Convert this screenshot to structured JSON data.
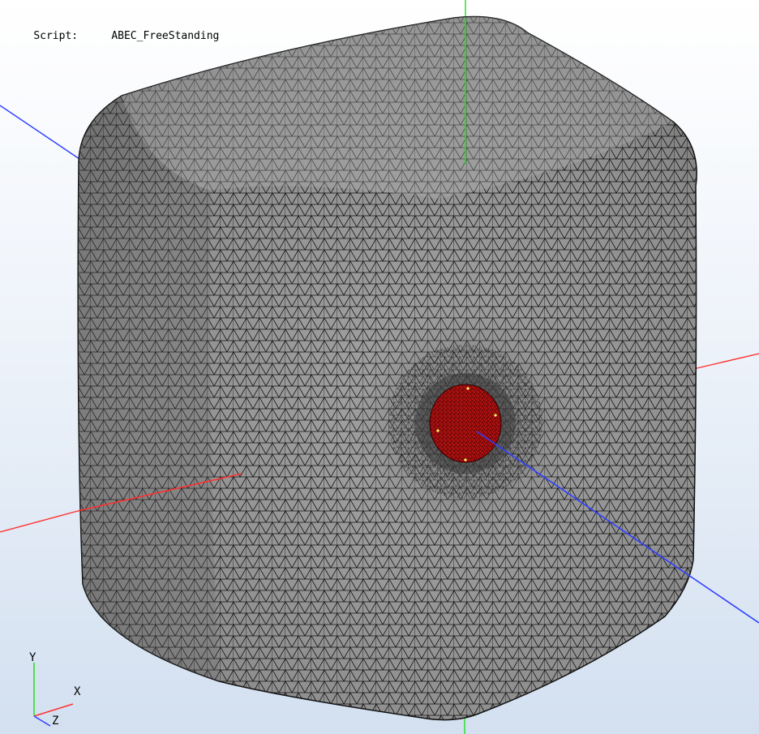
{
  "script_info": {
    "label": "Script:",
    "value": "ABEC_FreeStanding"
  },
  "triad": {
    "x_label": "X",
    "y_label": "Y",
    "z_label": "Z"
  },
  "colors": {
    "x_axis": "#ff3030",
    "y_axis": "#22dd22",
    "z_axis": "#3040ff",
    "mesh_fill": "#8f8f8f",
    "mesh_lines": "#111111",
    "driver": "#b31212"
  },
  "model": {
    "name": "ABEC_FreeStanding",
    "type": "boundary-element mesh",
    "shape": "rounded cube",
    "driver": "circular radiating element"
  }
}
